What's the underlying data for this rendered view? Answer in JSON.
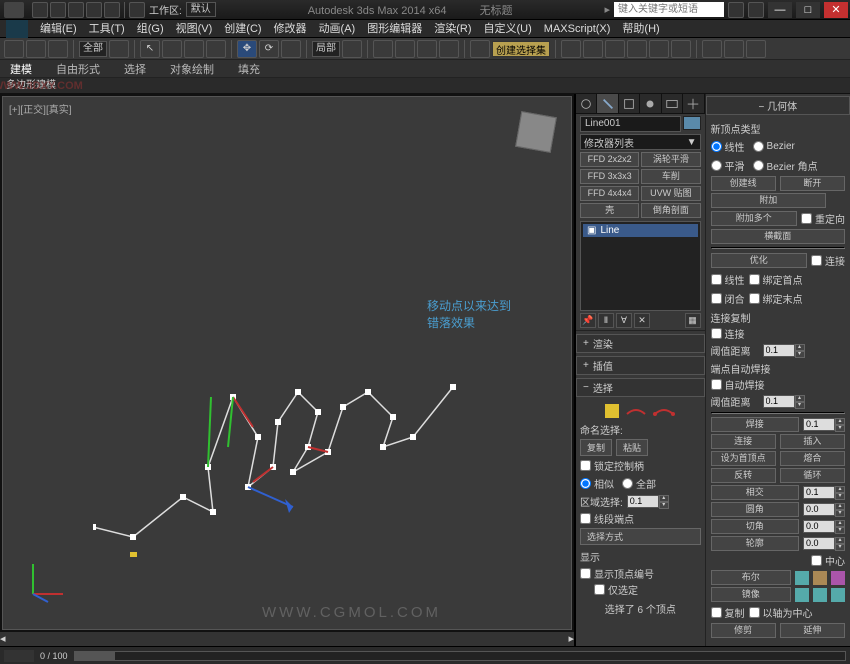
{
  "titlebar": {
    "workspace_label": "工作区:",
    "workspace_value": "默认",
    "app_title": "Autodesk 3ds Max  2014 x64",
    "doc_title": "无标题",
    "search_placeholder": "键入关键字或短语"
  },
  "menu": {
    "edit": "编辑(E)",
    "tools": "工具(T)",
    "group": "组(G)",
    "views": "视图(V)",
    "create": "创建(C)",
    "modifiers": "修改器",
    "animation": "动画(A)",
    "graph": "图形编辑器",
    "render": "渲染(R)",
    "custom": "自定义(U)",
    "maxscript": "MAXScript(X)",
    "help": "帮助(H)"
  },
  "toolbar": {
    "scope": "全部",
    "snap_mode": "局部",
    "selset_label": "创建选择集"
  },
  "ribbon": {
    "tab1": "建模",
    "tab2": "自由形式",
    "tab3": "选择",
    "tab4": "对象绘制",
    "tab5": "填充",
    "subtab": "多边形建模"
  },
  "viewport": {
    "label": "[+][正交][真实]",
    "hint_line1": "移动点以来达到",
    "hint_line2": "错落效果",
    "watermark_tl": "WWW.3DXY.COM",
    "watermark_br": "WWW.CGMOL.COM"
  },
  "cmd": {
    "object_name": "Line001",
    "modifier_list": "修改器列表",
    "mods": [
      "FFD 2x2x2",
      "涡轮平滑",
      "FFD 3x3x3",
      "车削",
      "FFD 4x4x4",
      "UVW 贴图",
      "壳",
      "倒角剖面"
    ],
    "stack_item": "Line",
    "rollout_render": "渲染",
    "rollout_interp": "插值",
    "rollout_select": "选择",
    "named_sel_label": "命名选择:",
    "copy": "复制",
    "paste": "粘贴",
    "lock_handles": "锁定控制柄",
    "similar": "相似",
    "all": "全部",
    "area_select": "区域选择:",
    "area_val": "0.1",
    "seg_end": "线段端点",
    "select_method": "选择方式",
    "display": "显示",
    "show_vertex_num": "显示顶点编号",
    "selected_only": "仅选定",
    "status": "选择了 6 个顶点"
  },
  "geom": {
    "header": "几何体",
    "new_vertex_type": "新顶点类型",
    "linear": "线性",
    "bezier": "Bezier",
    "smooth": "平滑",
    "bezier_corner": "Bezier 角点",
    "create_line": "创建线",
    "break": "断开",
    "attach": "附加",
    "attach_mult": "附加多个",
    "reorient": "重定向",
    "cross_section": "横截面",
    "refine": "优化",
    "connect": "连接",
    "linear2": "线性",
    "bind_first": "绑定首点",
    "closed": "闭合",
    "bind_last": "绑定末点",
    "connect_copy": "连接复制",
    "connect2": "连接",
    "threshold_dist": "阈值距离",
    "threshold_val": "0.1",
    "end_auto_weld": "端点自动焊接",
    "auto_weld": "自动焊接",
    "threshold_dist2": "阈值距离",
    "threshold_val2": "0.1",
    "weld": "焊接",
    "weld_val": "0.1",
    "connect3": "连接",
    "insert": "插入",
    "make_first": "设为首顶点",
    "weld2": "熔合",
    "reverse": "反转",
    "cycle": "循环",
    "crossinsert": "相交",
    "cross_val": "0.1",
    "fillet": "圆角",
    "fillet_val": "0.0",
    "chamfer": "切角",
    "chamfer_val": "0.0",
    "outline": "轮廓",
    "outline_val": "0.0",
    "center": "中心",
    "boolean": "布尔",
    "mirror": "镜像",
    "about_pivot": "以轴为中心",
    "copy2": "复制",
    "trim": "修剪",
    "extend": "延伸"
  },
  "timeline": {
    "frame": "0 / 100"
  }
}
